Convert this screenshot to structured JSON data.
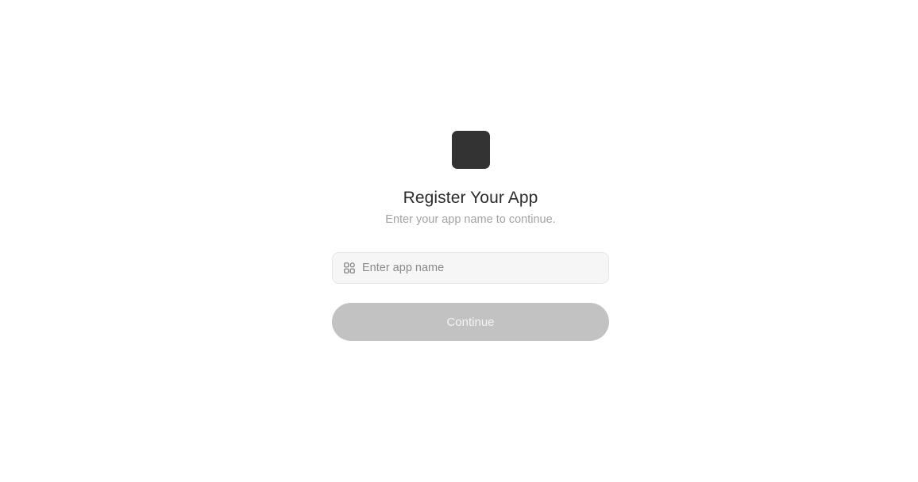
{
  "register": {
    "logo_icon": "app-logo-square",
    "title": "Register Your App",
    "subtitle": "Enter your app name to continue.",
    "input": {
      "icon": "grid-apps-icon",
      "placeholder": "Enter app name",
      "value": ""
    },
    "continue_label": "Continue",
    "continue_disabled": true
  },
  "colors": {
    "logo": "#333333",
    "button_disabled_bg": "#c2c2c2",
    "button_disabled_text": "#f4f4f4",
    "input_bg": "#f6f6f6",
    "input_border": "#e6e6e6",
    "subtitle": "#a3a3a3",
    "title": "#2b2b2b"
  }
}
